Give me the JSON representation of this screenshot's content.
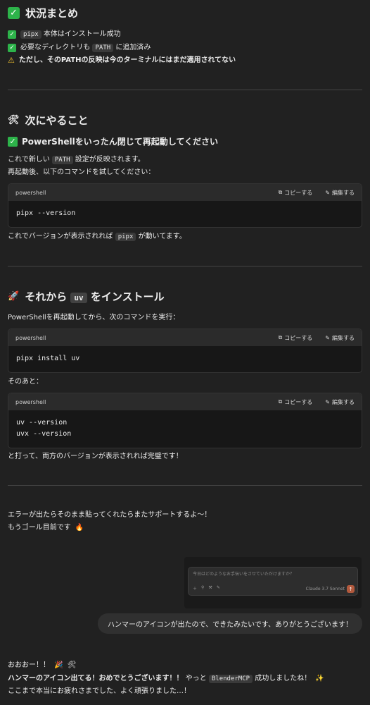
{
  "summary": {
    "heading": "状況まとめ",
    "item1_code": "pipx",
    "item1_text": " 本体はインストール成功",
    "item2_pre": "必要なディレクトリも ",
    "item2_code": "PATH",
    "item2_post": " に追加済み",
    "item3_pre": "ただし、",
    "item3_bold": "そのPATHの反映は今のターミナルにはまだ適用されてない"
  },
  "next": {
    "heading": "次にやること",
    "subheading": "PowerShellをいったん閉じて再起動してください",
    "line1_pre": "これで新しい ",
    "line1_code": "PATH",
    "line1_post": " 設定が反映されます。",
    "line2": "再起動後、以下のコマンドを試してください：",
    "after_pre": "これでバージョンが表示されれば ",
    "after_code": "pipx",
    "after_post": " が動いてます。"
  },
  "install": {
    "heading_pre": "それから ",
    "heading_code": "uv",
    "heading_post": " をインストール",
    "line1": "PowerShellを再起動してから、次のコマンドを実行：",
    "line2": "そのあと：",
    "final": "と打って、両方のバージョンが表示されれば完璧です！"
  },
  "codeblocks": [
    {
      "lang": "powershell",
      "copy": "コピーする",
      "edit": "編集する",
      "code": "pipx --version"
    },
    {
      "lang": "powershell",
      "copy": "コピーする",
      "edit": "編集する",
      "code": "pipx install uv"
    },
    {
      "lang": "powershell",
      "copy": "コピーする",
      "edit": "編集する",
      "code": "uv --version\nuvx --version"
    }
  ],
  "support": {
    "line1": "エラーが出たらそのまま貼ってくれたらまたサポートするよ〜！",
    "line2": "もうゴール目前です"
  },
  "screenshot": {
    "placeholder": "今日はどのようなお手伝いをさせていただけますか？",
    "model": "Claude 3.7 Sonnet"
  },
  "user_message": "ハンマーのアイコンが出たので、できたみたいです、ありがとうございます！",
  "reply": {
    "line1": "おおおー！！",
    "line2_bold": "ハンマーのアイコン出てる！おめでとうございます！！",
    "line2_mid": " やっと ",
    "line2_code": "BlenderMCP",
    "line2_post": " 成功しましたね！",
    "line3": "ここまで本当にお疲れさまでした、よく頑張りました…！"
  },
  "colors": {
    "background": "#212121",
    "check": "#2db34a",
    "warning": "#f2c230",
    "send": "#b2593d"
  }
}
